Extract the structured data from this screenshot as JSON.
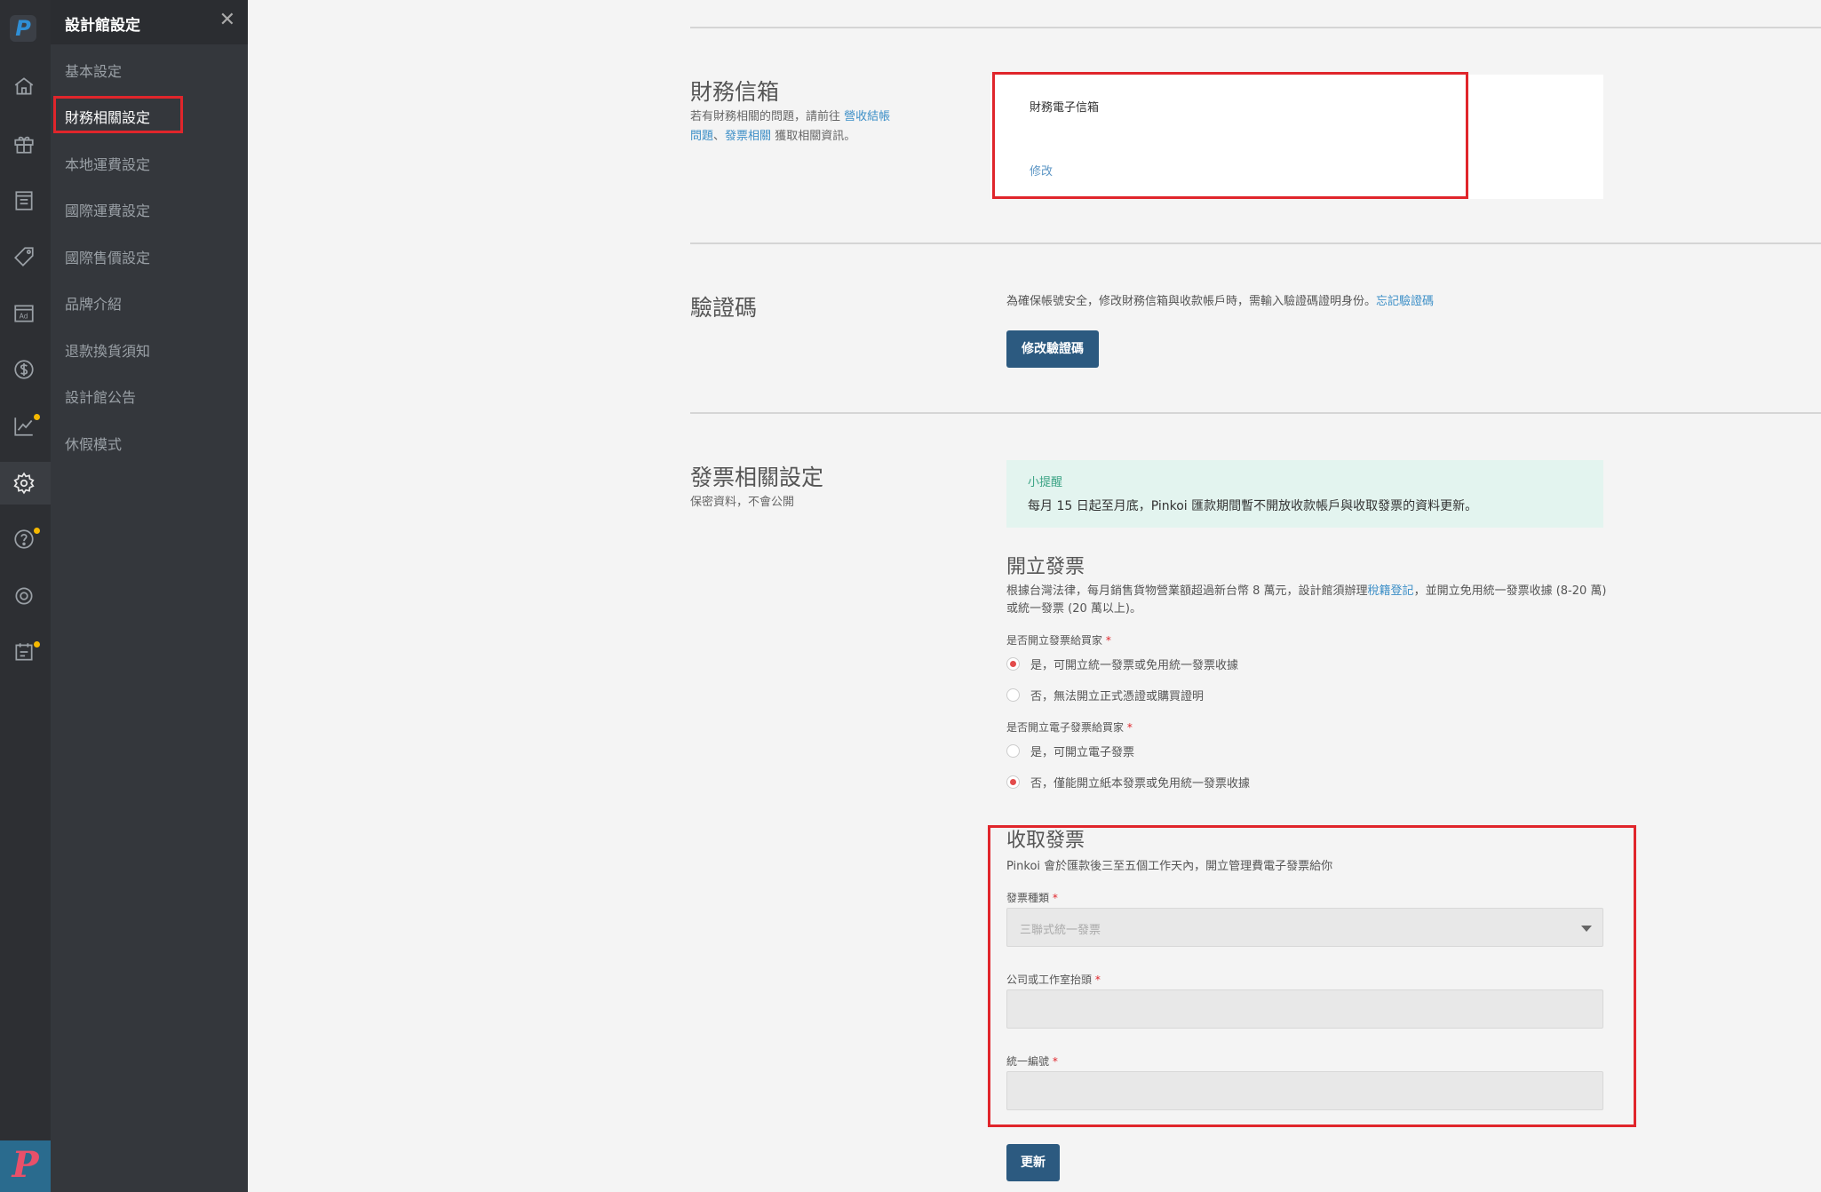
{
  "rail": {
    "logo": "P",
    "icons": [
      "home-icon",
      "gift-icon",
      "list-icon",
      "tag-icon",
      "ad-icon",
      "dollar-icon",
      "chart-icon",
      "settings-icon",
      "help-icon",
      "gear-icon",
      "notice-icon"
    ],
    "bottom_logo": "P"
  },
  "subnav": {
    "title": "設計館設定",
    "close": "✕",
    "items": [
      {
        "label": "基本設定"
      },
      {
        "label": "財務相關設定"
      },
      {
        "label": "本地運費設定"
      },
      {
        "label": "國際運費設定"
      },
      {
        "label": "國際售價設定"
      },
      {
        "label": "品牌介紹"
      },
      {
        "label": "退款換貨須知"
      },
      {
        "label": "設計館公告"
      },
      {
        "label": "休假模式"
      }
    ]
  },
  "finance_email": {
    "title": "財務信箱",
    "desc_prefix": "若有財務相關的問題，請前往",
    "desc_link1": "營收結帳問題",
    "desc_sep": "、",
    "desc_link2": "發票相關",
    "desc_suffix": "獲取相關資訊。",
    "field_label": "財務電子信箱",
    "edit_link": "修改"
  },
  "verify": {
    "title": "驗證碼",
    "note": "為確保帳號安全，修改財務信箱與收款帳戶時，需輸入驗證碼證明身份。",
    "forgot_link": "忘記驗證碼",
    "button": "修改驗證碼"
  },
  "invoice": {
    "title": "發票相關設定",
    "desc": "保密資料，不會公開",
    "notice_title": "小提醒",
    "notice_text": "每月 15 日起至月底，Pinkoi 匯款期間暫不開放收款帳戶與收取發票的資料更新。",
    "issue_title": "開立發票",
    "issue_para_1": "根據台灣法律，每月銷售貨物營業額超過新台幣 8 萬元，設計館須辦理",
    "issue_para_link": "稅籍登記",
    "issue_para_2": "，並開立免用統一發票收據 (8-20 萬) 或統一發票 (20 萬以上)。",
    "q1_label": "是否開立發票給買家",
    "q1_opt1": "是，可開立統一發票或免用統一發票收據",
    "q1_opt2": "否，無法開立正式憑證或購買證明",
    "q2_label": "是否開立電子發票給買家",
    "q2_opt1": "是，可開立電子發票",
    "q2_opt2": "否，僅能開立紙本發票或免用統一發票收據",
    "receive_title": "收取發票",
    "receive_desc": "Pinkoi 會於匯款後三至五個工作天內，開立管理費電子發票給你",
    "type_label": "發票種類",
    "type_value": "三聯式統一發票",
    "company_label": "公司或工作室抬頭",
    "tax_label": "統一編號",
    "required_mark": "*",
    "update_button": "更新"
  },
  "colors": {
    "accent": "#2c5a80",
    "highlight": "#e0252b",
    "link": "#3d8fc7"
  }
}
